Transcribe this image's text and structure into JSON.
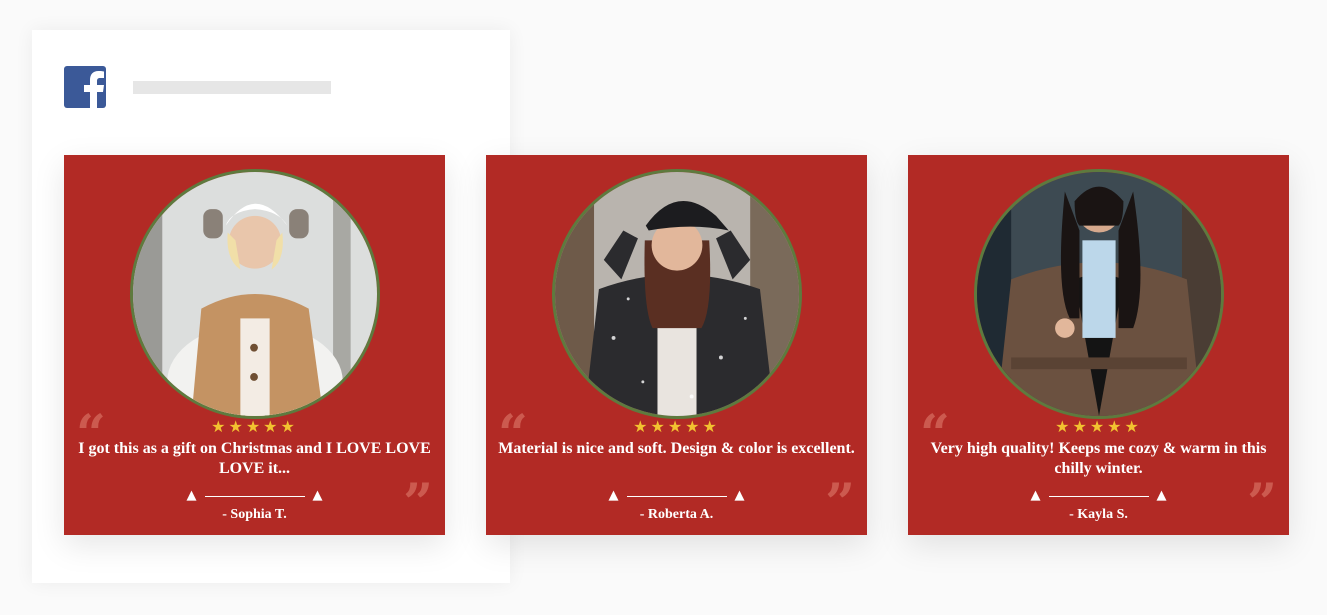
{
  "social": {
    "icon": "facebook-icon",
    "brand_color": "#3b5998"
  },
  "theme": {
    "card_bg": "#b22a25",
    "ring": "#5e7a3e",
    "star": "#f2c230"
  },
  "reviews": [
    {
      "stars": "★★★★★",
      "rating": 5,
      "quote_open": "“",
      "quote_close": "”",
      "text": "I got this as a gift on Christmas and I LOVE LOVE LOVE it...",
      "author": "- Sophia T.",
      "photo_icon": "woman-tan-coat-photo"
    },
    {
      "stars": "★★★★★",
      "rating": 5,
      "quote_open": "“",
      "quote_close": "”",
      "text": "Material is nice and soft. Design & color is excellent.",
      "author": "- Roberta A.",
      "photo_icon": "woman-black-jacket-photo"
    },
    {
      "stars": "★★★★★",
      "rating": 5,
      "quote_open": "“",
      "quote_close": "”",
      "text": "Very high quality! Keeps me cozy & warm in this chilly winter.",
      "author": "- Kayla S.",
      "photo_icon": "woman-brown-coat-photo"
    }
  ]
}
